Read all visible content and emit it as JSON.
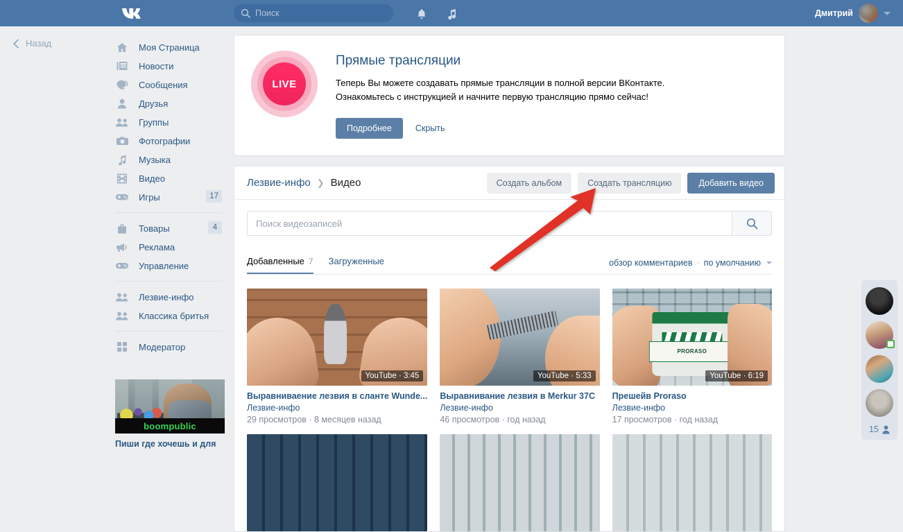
{
  "header": {
    "logo_icon": "vk-logo-icon",
    "search": {
      "placeholder": "Поиск",
      "value": "",
      "icon": "search-icon"
    },
    "notifications_icon": "bell-icon",
    "music_icon": "music-note-icon",
    "user_name": "Дмитрий",
    "avatar_icon": "user-avatar",
    "dropdown_icon": "chevron-down-icon",
    "brand_color": "#4a76a8"
  },
  "back": {
    "label": "Назад",
    "icon": "chevron-left-icon"
  },
  "sidebar": {
    "items": [
      {
        "label": "Моя Страница",
        "icon": "home-icon",
        "count": ""
      },
      {
        "label": "Новости",
        "icon": "news-icon",
        "count": ""
      },
      {
        "label": "Сообщения",
        "icon": "message-icon",
        "count": ""
      },
      {
        "label": "Друзья",
        "icon": "person-icon",
        "count": ""
      },
      {
        "label": "Группы",
        "icon": "people-icon",
        "count": ""
      },
      {
        "label": "Фотографии",
        "icon": "camera-icon",
        "count": ""
      },
      {
        "label": "Музыка",
        "icon": "music-note-icon",
        "count": ""
      },
      {
        "label": "Видео",
        "icon": "film-icon",
        "count": ""
      },
      {
        "label": "Игры",
        "icon": "gamepad-icon",
        "count": "17"
      }
    ],
    "items2": [
      {
        "label": "Товары",
        "icon": "bag-icon",
        "count": "4"
      },
      {
        "label": "Реклама",
        "icon": "megaphone-icon",
        "count": ""
      },
      {
        "label": "Управление",
        "icon": "gamepad-icon",
        "count": ""
      }
    ],
    "items3": [
      {
        "label": "Лезвие-инфо",
        "icon": "people-icon",
        "count": ""
      },
      {
        "label": "Классика бритья",
        "icon": "people-icon",
        "count": ""
      }
    ],
    "items4": [
      {
        "label": "Модератор",
        "icon": "grid-icon",
        "count": ""
      }
    ]
  },
  "ad": {
    "brand": "boompublic",
    "caption": "Пиши где хочешь и для"
  },
  "live_banner": {
    "badge_text": "LIVE",
    "title": "Прямые трансляции",
    "line1": "Теперь Вы можете создавать прямые трансляции в полной версии ВКонтакте.",
    "line2": "Ознакомьтесь с инструкцией и начните первую трансляцию прямо сейчас!",
    "primary_label": "Подробнее",
    "dismiss_label": "Скрыть",
    "accent_color": "#ff2d63"
  },
  "video_module": {
    "breadcrumb_parent": "Лезвие-инфо",
    "breadcrumb_sep": "❯",
    "breadcrumb_current": "Видео",
    "actions": [
      {
        "label": "Создать альбом",
        "style": "grey"
      },
      {
        "label": "Создать трансляцию",
        "style": "grey"
      },
      {
        "label": "Добавить видео",
        "style": "primary"
      }
    ],
    "search": {
      "placeholder": "Поиск видеозаписей",
      "value": "",
      "icon": "search-icon"
    },
    "tabs": [
      {
        "label": "Добавленные",
        "count": "7",
        "active": true
      },
      {
        "label": "Загруженные",
        "count": "",
        "active": false
      }
    ],
    "sort": {
      "comments_label": "обзор комментариев",
      "separator": "·",
      "order_label": "по умолчанию",
      "caret_icon": "chevron-down-icon"
    },
    "videos": [
      {
        "title": "Выравниваение лезвия в сланте Wunde...",
        "owner": "Лезвие-инфо",
        "meta": "29 просмотров · 8 месяцев назад",
        "duration": "YouTube · 3:45",
        "art": "th-brick"
      },
      {
        "title": "Выравнивание лезвия в Merkur 37C",
        "owner": "Лезвие-инфо",
        "meta": "46 просмотров · год назад",
        "duration": "YouTube · 5:33",
        "art": "th-comb"
      },
      {
        "title": "Прешейв Proraso",
        "owner": "Лезвие-инфо",
        "meta": "17 просмотров · год назад",
        "duration": "YouTube · 6:19",
        "art": "th-tile"
      }
    ],
    "jar_brand": "PRORASO"
  },
  "online_panel": {
    "avatars": [
      {
        "name": "avatar-1",
        "online": false
      },
      {
        "name": "avatar-2",
        "online": true
      },
      {
        "name": "avatar-3",
        "online": false
      },
      {
        "name": "avatar-4",
        "online": false
      }
    ],
    "count": "15",
    "count_icon": "person-icon"
  },
  "annotation": {
    "arrow_color": "#e03127",
    "points_to": "Создать трансляцию"
  }
}
